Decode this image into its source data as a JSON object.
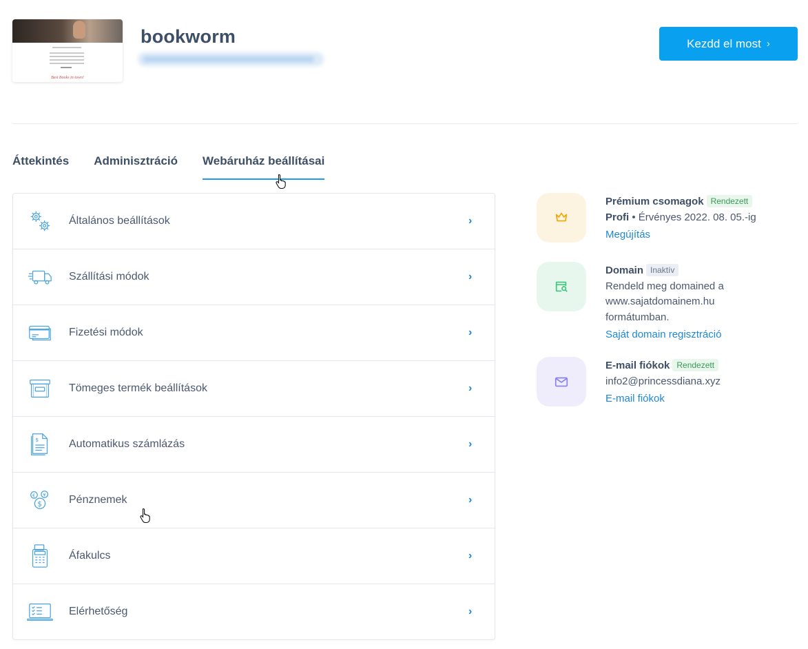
{
  "header": {
    "site_name": "bookworm",
    "thumbnail_caption": "Best Books in town!",
    "cta_label": "Kezdd el most"
  },
  "tabs": [
    {
      "label": "Áttekintés",
      "active": false
    },
    {
      "label": "Adminisztráció",
      "active": false
    },
    {
      "label": "Webáruház beállításai",
      "active": true
    }
  ],
  "settings": [
    {
      "label": "Általános beállítások",
      "icon": "gears-icon"
    },
    {
      "label": "Szállítási módok",
      "icon": "truck-icon"
    },
    {
      "label": "Fizetési módok",
      "icon": "credit-card-icon"
    },
    {
      "label": "Tömeges termék beállítások",
      "icon": "box-icon"
    },
    {
      "label": "Automatikus számlázás",
      "icon": "invoice-icon"
    },
    {
      "label": "Pénznemek",
      "icon": "currency-coins-icon"
    },
    {
      "label": "Áfakulcs",
      "icon": "calculator-icon"
    },
    {
      "label": "Elérhetőség",
      "icon": "laptop-checklist-icon"
    }
  ],
  "services": {
    "premium": {
      "title": "Prémium csomagok",
      "badge": "Rendezett",
      "plan": "Profi",
      "validity": "• Érvényes 2022. 08. 05.-ig",
      "link": "Megújítás",
      "icon": "crown-icon",
      "bg": "#fdf3e1",
      "color": "#f0a500"
    },
    "domain": {
      "title": "Domain",
      "badge": "Inaktív",
      "desc1": "Rendeld meg domained a",
      "desc2": "www.sajatdomainem.hu",
      "desc3": "formátumban.",
      "link": "Saját domain regisztráció",
      "icon": "browser-search-icon",
      "bg": "#e7f7ee",
      "color": "#3bc77a"
    },
    "email": {
      "title": "E-mail fiókok",
      "badge": "Rendezett",
      "address": "info2@princessdiana.xyz",
      "link": "E-mail fiókok",
      "icon": "envelope-icon",
      "bg": "#efedfc",
      "color": "#8b7ff0"
    }
  },
  "colors": {
    "accent": "#0aa0f0",
    "link": "#1e88d6",
    "text": "#3d4f66"
  }
}
